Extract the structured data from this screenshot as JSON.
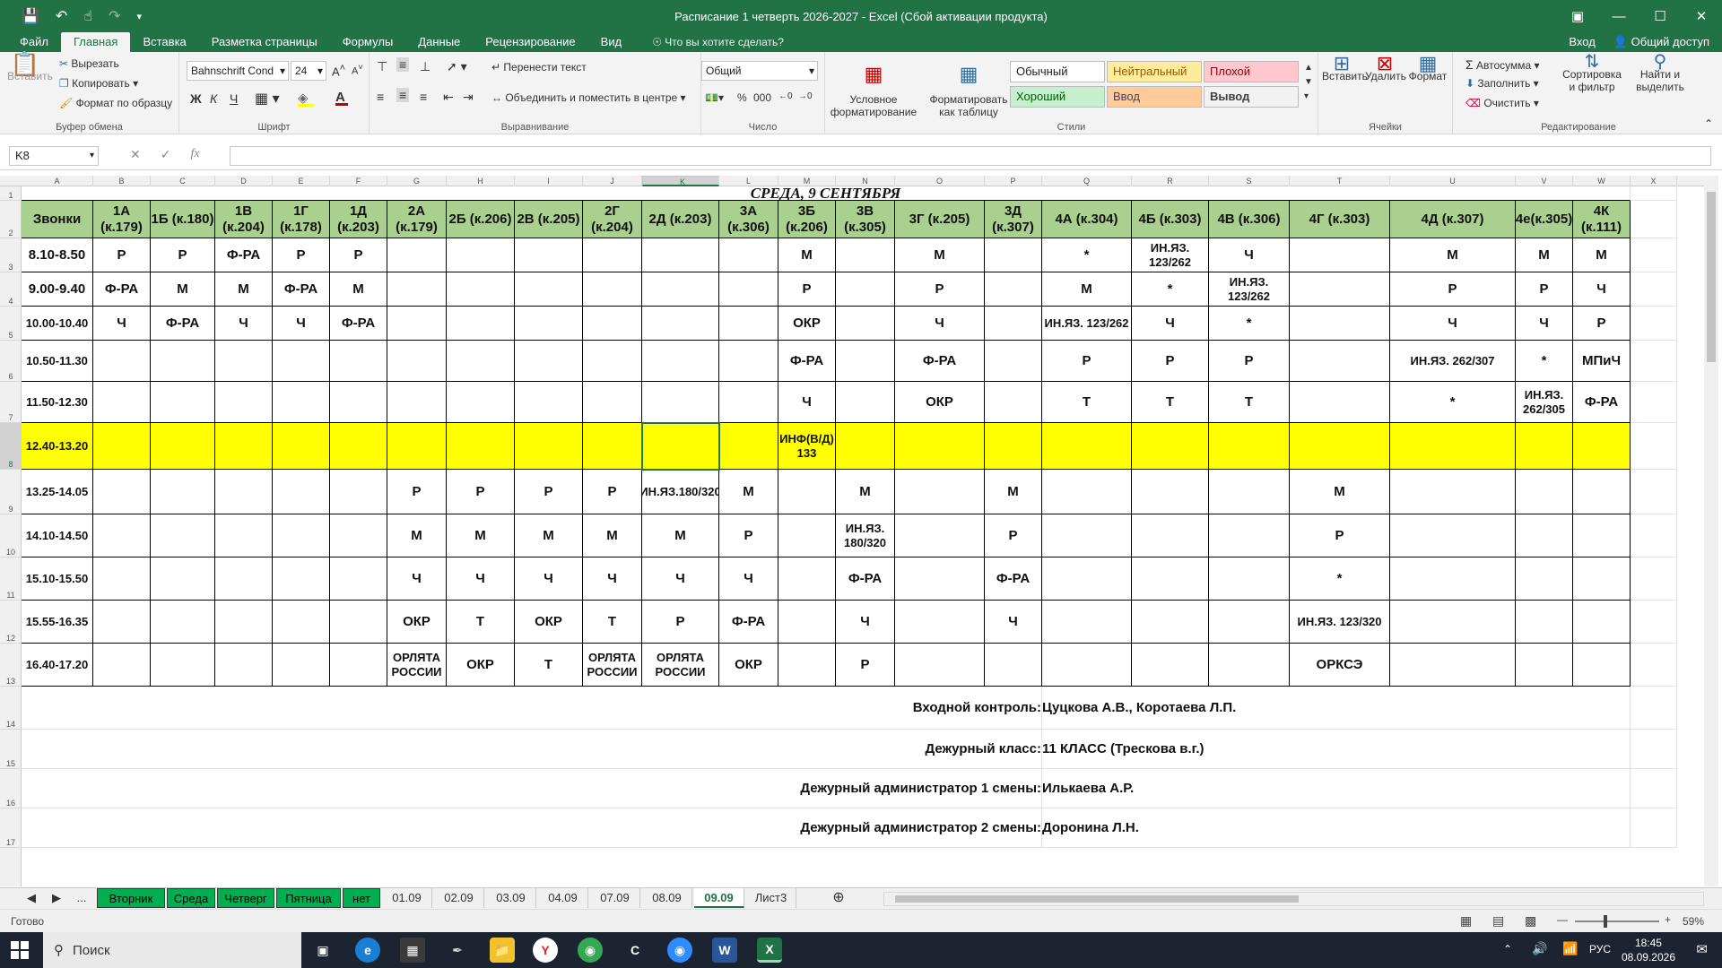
{
  "titlebar": {
    "title": "Расписание 1 четверть 2026-2027 - Excel (Сбой активации продукта)"
  },
  "menu": {
    "tabs": [
      "Файл",
      "Главная",
      "Вставка",
      "Разметка страницы",
      "Формулы",
      "Данные",
      "Рецензирование",
      "Вид"
    ],
    "tell_me": "Что вы хотите сделать?",
    "signin": "Вход",
    "share": "Общий доступ"
  },
  "ribbon": {
    "paste": "Вставить",
    "cut": "Вырезать",
    "copy": "Копировать",
    "format_painter": "Формат по образцу",
    "clipboard_label": "Буфер обмена",
    "font_name": "Bahnschrift Cond",
    "font_size": "24",
    "bold": "Ж",
    "italic": "К",
    "underline": "Ч",
    "font_label": "Шрифт",
    "wrap_text": "Перенести текст",
    "merge_center": "Объединить и поместить в центре",
    "alignment_label": "Выравнивание",
    "number_format": "Общий",
    "number_label": "Число",
    "cond_format": "Условное\nформатирование",
    "format_table": "Форматировать\nкак таблицу",
    "styles": [
      "Обычный",
      "Нейтральный",
      "Плохой",
      "Хороший",
      "Ввод",
      "Вывод"
    ],
    "styles_label": "Стили",
    "insert": "Вставить",
    "delete": "Удалить",
    "format": "Формат",
    "cells_label": "Ячейки",
    "autosum": "Автосумма",
    "fill": "Заполнить",
    "clear": "Очистить",
    "sort_filter": "Сортировка\nи фильтр",
    "find_select": "Найти и\nвыделить",
    "editing_label": "Редактирование"
  },
  "formula_bar": {
    "name_box": "K8",
    "formula": ""
  },
  "sheet": {
    "columns": [
      "A",
      "B",
      "C",
      "D",
      "E",
      "F",
      "G",
      "H",
      "I",
      "J",
      "K",
      "L",
      "M",
      "N",
      "O",
      "P",
      "Q",
      "R",
      "S",
      "T",
      "U",
      "V",
      "W",
      "X"
    ],
    "rows": [
      "1",
      "2",
      "3",
      "4",
      "5",
      "6",
      "7",
      "8",
      "9",
      "10",
      "11",
      "12",
      "13",
      "14",
      "15",
      "16",
      "17"
    ],
    "title": "СРЕДА, 9 СЕНТЯБРЯ",
    "headers": [
      "Звонки",
      "1А (к.179)",
      "1Б (к.180)",
      "1В (к.204)",
      "1Г (к.178)",
      "1Д\n(к.203)",
      "2А (к.179)",
      "2Б (к.206)",
      "2В (к.205)",
      "2Г\n(к.204)",
      "2Д (к.203)",
      "3А\n(к.306)",
      "3Б\n(к.206)",
      "3В\n(к.305)",
      "3Г (к.205)",
      "3Д\n(к.307)",
      "4А (к.304)",
      "4Б (к.303)",
      "4В (к.306)",
      "4Г (к.303)",
      "4Д (к.307)",
      "4е(к.305)",
      "4К (к.111)"
    ],
    "lessons": [
      [
        "8.10-8.50",
        "Р",
        "Р",
        "Ф-РА",
        "Р",
        "Р",
        "",
        "",
        "",
        "",
        "",
        "",
        "М",
        "",
        "М",
        "",
        "*",
        "ИН.ЯЗ.\n123/262",
        "Ч",
        "",
        "М",
        "М",
        "М"
      ],
      [
        "9.00-9.40",
        "Ф-РА",
        "М",
        "М",
        "Ф-РА",
        "М",
        "",
        "",
        "",
        "",
        "",
        "",
        "Р",
        "",
        "Р",
        "",
        "М",
        "*",
        "ИН.ЯЗ. 123/262",
        "",
        "Р",
        "Р",
        "Ч"
      ],
      [
        "10.00-10.40",
        "Ч",
        "Ф-РА",
        "Ч",
        "Ч",
        "Ф-РА",
        "",
        "",
        "",
        "",
        "",
        "",
        "ОКР",
        "",
        "Ч",
        "",
        "ИН.ЯЗ. 123/262",
        "Ч",
        "*",
        "",
        "Ч",
        "Ч",
        "Р"
      ],
      [
        "10.50-11.30",
        "",
        "",
        "",
        "",
        "",
        "",
        "",
        "",
        "",
        "",
        "",
        "Ф-РА",
        "",
        "Ф-РА",
        "",
        "Р",
        "Р",
        "Р",
        "",
        "ИН.ЯЗ. 262/307",
        "*",
        "МПиЧ"
      ],
      [
        "11.50-12.30",
        "",
        "",
        "",
        "",
        "",
        "",
        "",
        "",
        "",
        "",
        "",
        "Ч",
        "",
        "ОКР",
        "",
        "Т",
        "Т",
        "Т",
        "",
        "*",
        "ИН.ЯЗ.\n262/305",
        "Ф-РА"
      ],
      [
        "12.40-13.20",
        "",
        "",
        "",
        "",
        "",
        "",
        "",
        "",
        "",
        "",
        "",
        "ИНФ(В/Д)\n133",
        "",
        "",
        "",
        "",
        "",
        "",
        "",
        "",
        "",
        ""
      ],
      [
        "13.25-14.05",
        "",
        "",
        "",
        "",
        "",
        "Р",
        "Р",
        "Р",
        "Р",
        "ИН.ЯЗ.180/320",
        "М",
        "",
        "М",
        "",
        "М",
        "",
        "",
        "",
        "М",
        "",
        "",
        ""
      ],
      [
        "14.10-14.50",
        "",
        "",
        "",
        "",
        "",
        "М",
        "М",
        "М",
        "М",
        "М",
        "Р",
        "",
        "ИН.ЯЗ.\n180/320",
        "",
        "Р",
        "",
        "",
        "",
        "Р",
        "",
        "",
        ""
      ],
      [
        "15.10-15.50",
        "",
        "",
        "",
        "",
        "",
        "Ч",
        "Ч",
        "Ч",
        "Ч",
        "Ч",
        "Ч",
        "",
        "Ф-РА",
        "",
        "Ф-РА",
        "",
        "",
        "",
        "*",
        "",
        "",
        ""
      ],
      [
        "15.55-16.35",
        "",
        "",
        "",
        "",
        "",
        "ОКР",
        "Т",
        "ОКР",
        "Т",
        "Р",
        "Ф-РА",
        "",
        "Ч",
        "",
        "Ч",
        "",
        "",
        "",
        "ИН.ЯЗ. 123/320",
        "",
        "",
        ""
      ],
      [
        "16.40-17.20",
        "",
        "",
        "",
        "",
        "",
        "ОРЛЯТА\nРОССИИ",
        "ОКР",
        "Т",
        "ОРЛЯТА\nРОССИИ",
        "ОРЛЯТА\nРОССИИ",
        "ОКР",
        "",
        "Р",
        "",
        "",
        "",
        "",
        "",
        "ОРКСЭ",
        "",
        "",
        ""
      ]
    ],
    "footer": [
      {
        "label": "Входной контроль:",
        "value": "Цуцкова А.В., Коротаева Л.П."
      },
      {
        "label": "Дежурный класс:",
        "value": "11 КЛАСС (Трескова в.г.)"
      },
      {
        "label": "Дежурный администратор 1 смены:",
        "value": "Илькаева А.Р."
      },
      {
        "label": "Дежурный администратор 2 смены:",
        "value": "Доронина Л.Н."
      }
    ]
  },
  "sheet_tabs": {
    "nav_more": "...",
    "tabs": [
      "Вторник",
      "Среда",
      "Четверг",
      "Пятница",
      "нет",
      "01.09",
      "02.09",
      "03.09",
      "04.09",
      "07.09",
      "08.09",
      "09.09",
      "Лист3"
    ],
    "active": "09.09"
  },
  "status": {
    "ready": "Готово",
    "zoom": "59%"
  },
  "taskbar": {
    "search": "Поиск",
    "lang": "РУС",
    "time": "18:45",
    "date": "08.09.2026"
  },
  "colors": {
    "excel_green": "#217346",
    "header_green": "#a9d08e",
    "highlight_yellow": "#ffff00",
    "tab_green": "#00b050"
  }
}
